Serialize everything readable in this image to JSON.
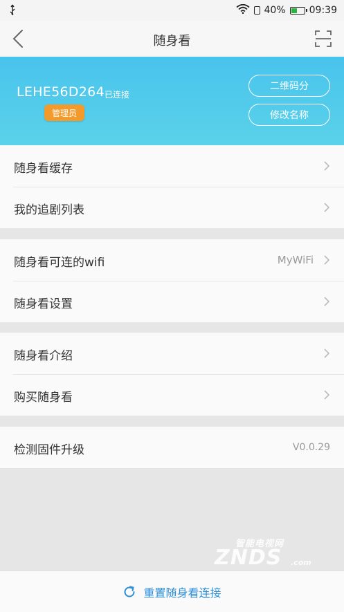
{
  "status_bar": {
    "usb_icon": "usb-icon",
    "wifi_icon": "wifi-icon",
    "sim_icon": "sim-card-icon",
    "battery_percent": "40%",
    "battery_level": 0.4,
    "time": "09:39"
  },
  "nav": {
    "back_icon": "chevron-left-icon",
    "title": "随身看",
    "scan_icon": "scan-icon"
  },
  "device": {
    "id": "LEHE56D264",
    "status": "已连接",
    "role": "管理员",
    "qr_share_label": "二维码分",
    "rename_label": "修改名称"
  },
  "menu_groups": [
    {
      "items": [
        {
          "label": "随身看缓存",
          "value": "",
          "arrow": true
        },
        {
          "label": "我的追剧列表",
          "value": "",
          "arrow": true
        }
      ]
    },
    {
      "items": [
        {
          "label": "随身看可连的wifi",
          "value": "MyWiFi",
          "arrow": true
        },
        {
          "label": "随身看设置",
          "value": "",
          "arrow": true
        }
      ]
    },
    {
      "items": [
        {
          "label": "随身看介绍",
          "value": "",
          "arrow": true
        },
        {
          "label": "购买随身看",
          "value": "",
          "arrow": true
        }
      ]
    },
    {
      "items": [
        {
          "label": "检测固件升级",
          "value": "V0.0.29",
          "arrow": false
        }
      ]
    }
  ],
  "watermark": {
    "cn": "智能电视网",
    "en": "ZNDS",
    "com": ".com"
  },
  "footer": {
    "reset_icon": "refresh-icon",
    "reset_label": "重置随身看连接"
  },
  "colors": {
    "banner_top": "#48c3ec",
    "banner_bottom": "#5bd2ea",
    "badge": "#f39a2c",
    "accent_blue": "#2d8fd8",
    "battery_green": "#2ab53a"
  }
}
